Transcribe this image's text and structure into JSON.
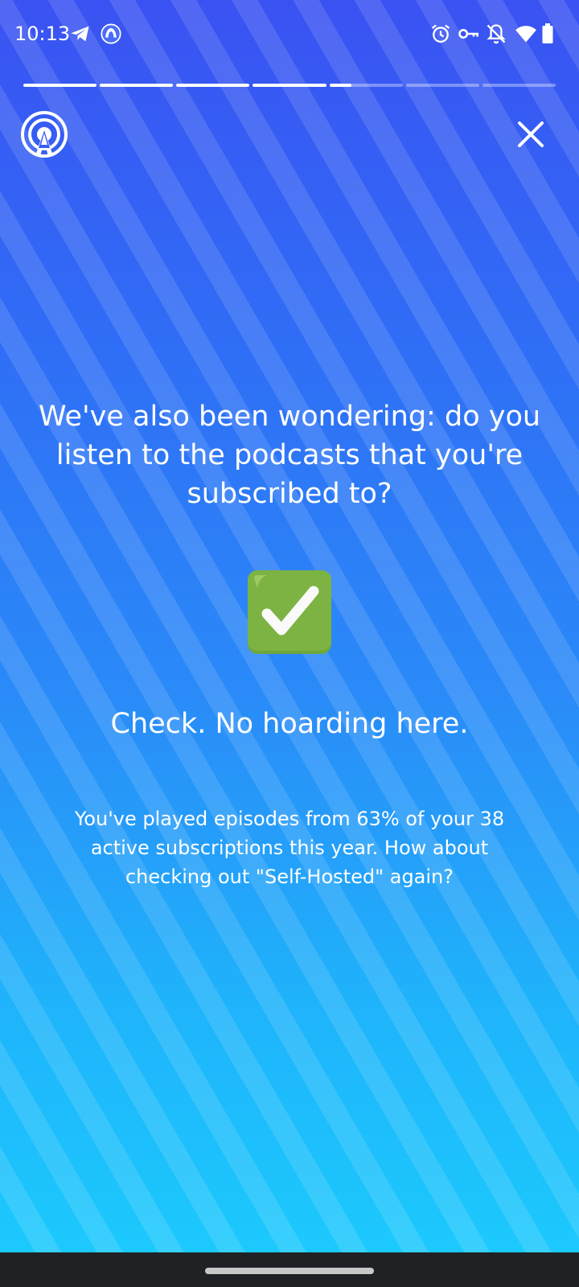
{
  "status_bar": {
    "time": "10:13",
    "left_icons": [
      "telegram-icon",
      "app-notification-icon"
    ],
    "right_icons": [
      "alarm-icon",
      "vpn-key-icon",
      "notifications-off-icon",
      "wifi-icon",
      "battery-icon"
    ]
  },
  "story": {
    "progress_segments": [
      1,
      1,
      1,
      1,
      0.3,
      0,
      0
    ],
    "logo_icon": "pocket-casts-logo-icon",
    "close_icon": "close-icon",
    "headline": "We've also been wondering: do you listen to the podcasts that you're subscribed to?",
    "emoji_icon": "check-mark-button-icon",
    "subhead": "Check. No hoarding here.",
    "body": "You've played episodes from 63% of your 38 active subscriptions this year. How about checking out \"Self-Hosted\" again?"
  },
  "colors": {
    "gradient_top": "#3a52f2",
    "gradient_bottom": "#1cc9fd",
    "text": "#ffffff",
    "check_green": "#7cb342",
    "nav_bar": "#202124"
  }
}
